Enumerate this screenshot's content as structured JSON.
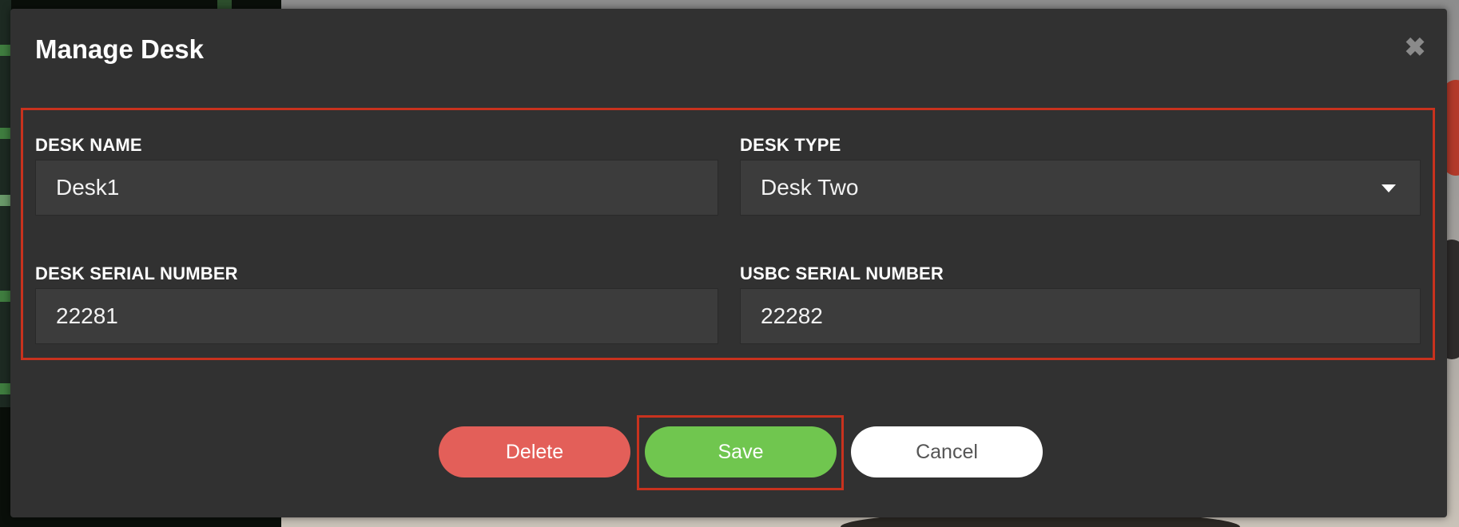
{
  "modal": {
    "title": "Manage Desk",
    "close_icon": "close-icon"
  },
  "form": {
    "desk_name": {
      "label": "DESK NAME",
      "value": "Desk1"
    },
    "desk_type": {
      "label": "DESK TYPE",
      "value": "Desk Two",
      "icon": "caret-down-icon"
    },
    "desk_serial": {
      "label": "DESK SERIAL NUMBER",
      "value": "22281"
    },
    "usbc_serial": {
      "label": "USBC SERIAL NUMBER",
      "value": "22282"
    }
  },
  "actions": {
    "delete_label": "Delete",
    "save_label": "Save",
    "cancel_label": "Cancel"
  },
  "colors": {
    "modal_bg": "#313131",
    "field_bg": "#3c3c3c",
    "delete": "#e35f59",
    "save": "#70c64f",
    "cancel": "#ffffff",
    "highlight": "#c8321e"
  }
}
